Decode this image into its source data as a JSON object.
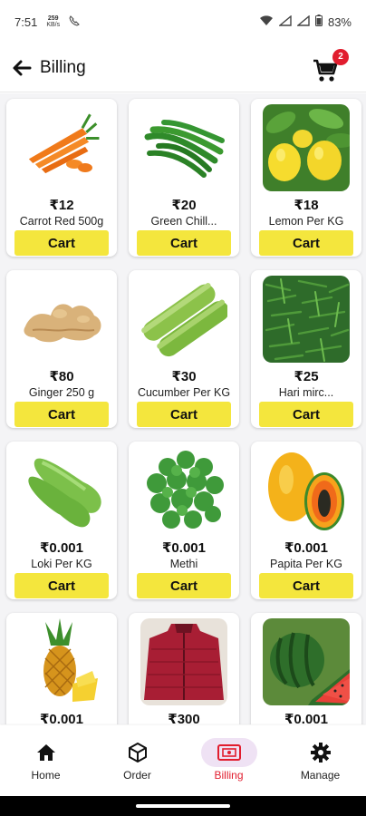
{
  "status_bar": {
    "time": "7:51",
    "net_speed_value": "259",
    "net_speed_unit": "KB/s",
    "battery": "83%"
  },
  "app_bar": {
    "title": "Billing",
    "cart_count": "2"
  },
  "products": [
    {
      "price": "₹12",
      "name": "Carrot Red 500g",
      "cart_label": "Cart",
      "image": "carrot"
    },
    {
      "price": "₹20",
      "name": "Green Chill...",
      "cart_label": "Cart",
      "image": "green-chilli"
    },
    {
      "price": "₹18",
      "name": "Lemon Per KG",
      "cart_label": "Cart",
      "image": "lemon"
    },
    {
      "price": "₹80",
      "name": "Ginger 250 g",
      "cart_label": "Cart",
      "image": "ginger"
    },
    {
      "price": "₹30",
      "name": "Cucumber Per KG",
      "cart_label": "Cart",
      "image": "cucumber"
    },
    {
      "price": "₹25",
      "name": "Hari mirc...",
      "cart_label": "Cart",
      "image": "hari-mirch"
    },
    {
      "price": "₹0.001",
      "name": "Loki Per KG",
      "cart_label": "Cart",
      "image": "bottle-gourd"
    },
    {
      "price": "₹0.001",
      "name": "Methi",
      "cart_label": "Cart",
      "image": "methi-leaves"
    },
    {
      "price": "₹0.001",
      "name": "Papita Per KG",
      "cart_label": "Cart",
      "image": "papaya"
    },
    {
      "price": "₹0.001",
      "name": "",
      "cart_label": "",
      "image": "pineapple"
    },
    {
      "price": "₹300",
      "name": "",
      "cart_label": "",
      "image": "red-jacket"
    },
    {
      "price": "₹0.001",
      "name": "",
      "cart_label": "",
      "image": "watermelon"
    }
  ],
  "bottom_nav": [
    {
      "label": "Home",
      "icon": "home-icon",
      "active": false
    },
    {
      "label": "Order",
      "icon": "box-icon",
      "active": false
    },
    {
      "label": "Billing",
      "icon": "billing-icon",
      "active": true
    },
    {
      "label": "Manage",
      "icon": "gear-icon",
      "active": false
    }
  ],
  "colors": {
    "cart_button": "#f4e63d",
    "badge": "#e11d2e",
    "active_nav_label": "#e11d2e",
    "active_nav_pill": "#efe2f4"
  }
}
